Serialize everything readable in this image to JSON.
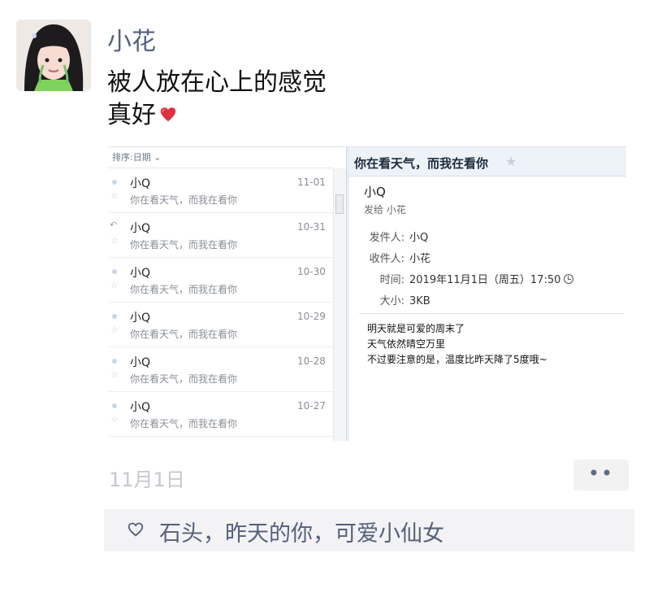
{
  "post": {
    "author": "小花",
    "text_line1": "被人放在心上的感觉",
    "text_line2": "真好",
    "date": "11月1日",
    "more_label": "••",
    "likes": "石头，昨天的你，可爱小仙女",
    "heart_emoji": "heart-emoji"
  },
  "mail_client": {
    "sort_label": "排序:日期 ⌄",
    "items": [
      {
        "sender": "小Q",
        "preview": "你在看天气，而我在看你",
        "date": "11-01"
      },
      {
        "sender": "小Q",
        "preview": "你在看天气，而我在看你",
        "date": "10-31"
      },
      {
        "sender": "小Q",
        "preview": "你在看天气，而我在看你",
        "date": "10-30"
      },
      {
        "sender": "小Q",
        "preview": "你在看天气，而我在看你",
        "date": "10-29"
      },
      {
        "sender": "小Q",
        "preview": "你在看天气，而我在看你",
        "date": "10-28"
      },
      {
        "sender": "小Q",
        "preview": "你在看天气，而我在看你",
        "date": "10-27"
      }
    ],
    "open_mail": {
      "subject": "你在看天气，而我在看你",
      "sender": "小Q",
      "to_line": "发给 小花",
      "from_label": "发件人:",
      "from_value": "小Q",
      "recipient_label": "收件人:",
      "recipient_value": "小花",
      "time_label": "时间:",
      "time_value": "2019年11月1日（周五）17:50",
      "size_label": "大小:",
      "size_value": "3KB",
      "body": [
        "明天就是可爱的周末了",
        "天气依然晴空万里",
        "不过要注意的是，温度比昨天降了5度哦~"
      ]
    }
  },
  "colors": {
    "name_blue": "#55607d",
    "accent_red": "#e0303c",
    "header_bg": "#eef3fa"
  }
}
